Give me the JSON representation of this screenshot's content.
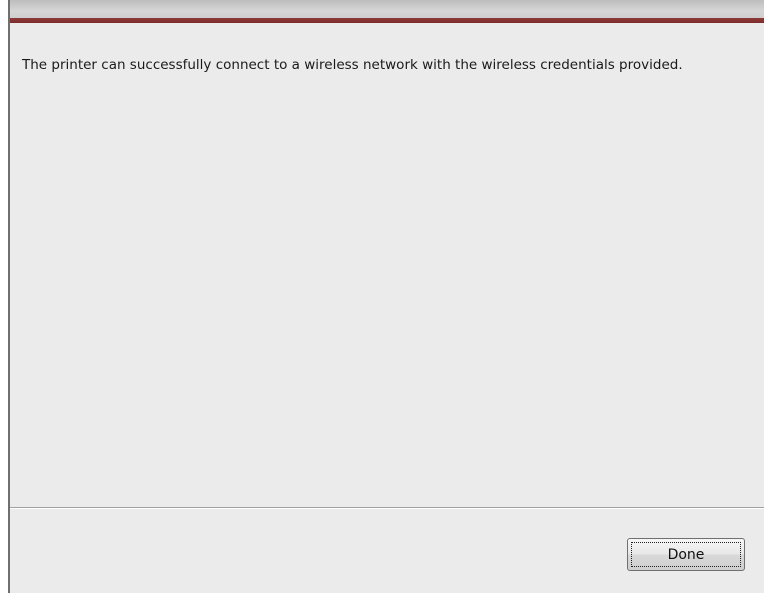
{
  "dialog": {
    "message": "The printer can successfully connect to a wireless network with the wireless credentials provided.",
    "accent_color": "#7d2c2c"
  },
  "footer": {
    "done_label": "Done"
  }
}
